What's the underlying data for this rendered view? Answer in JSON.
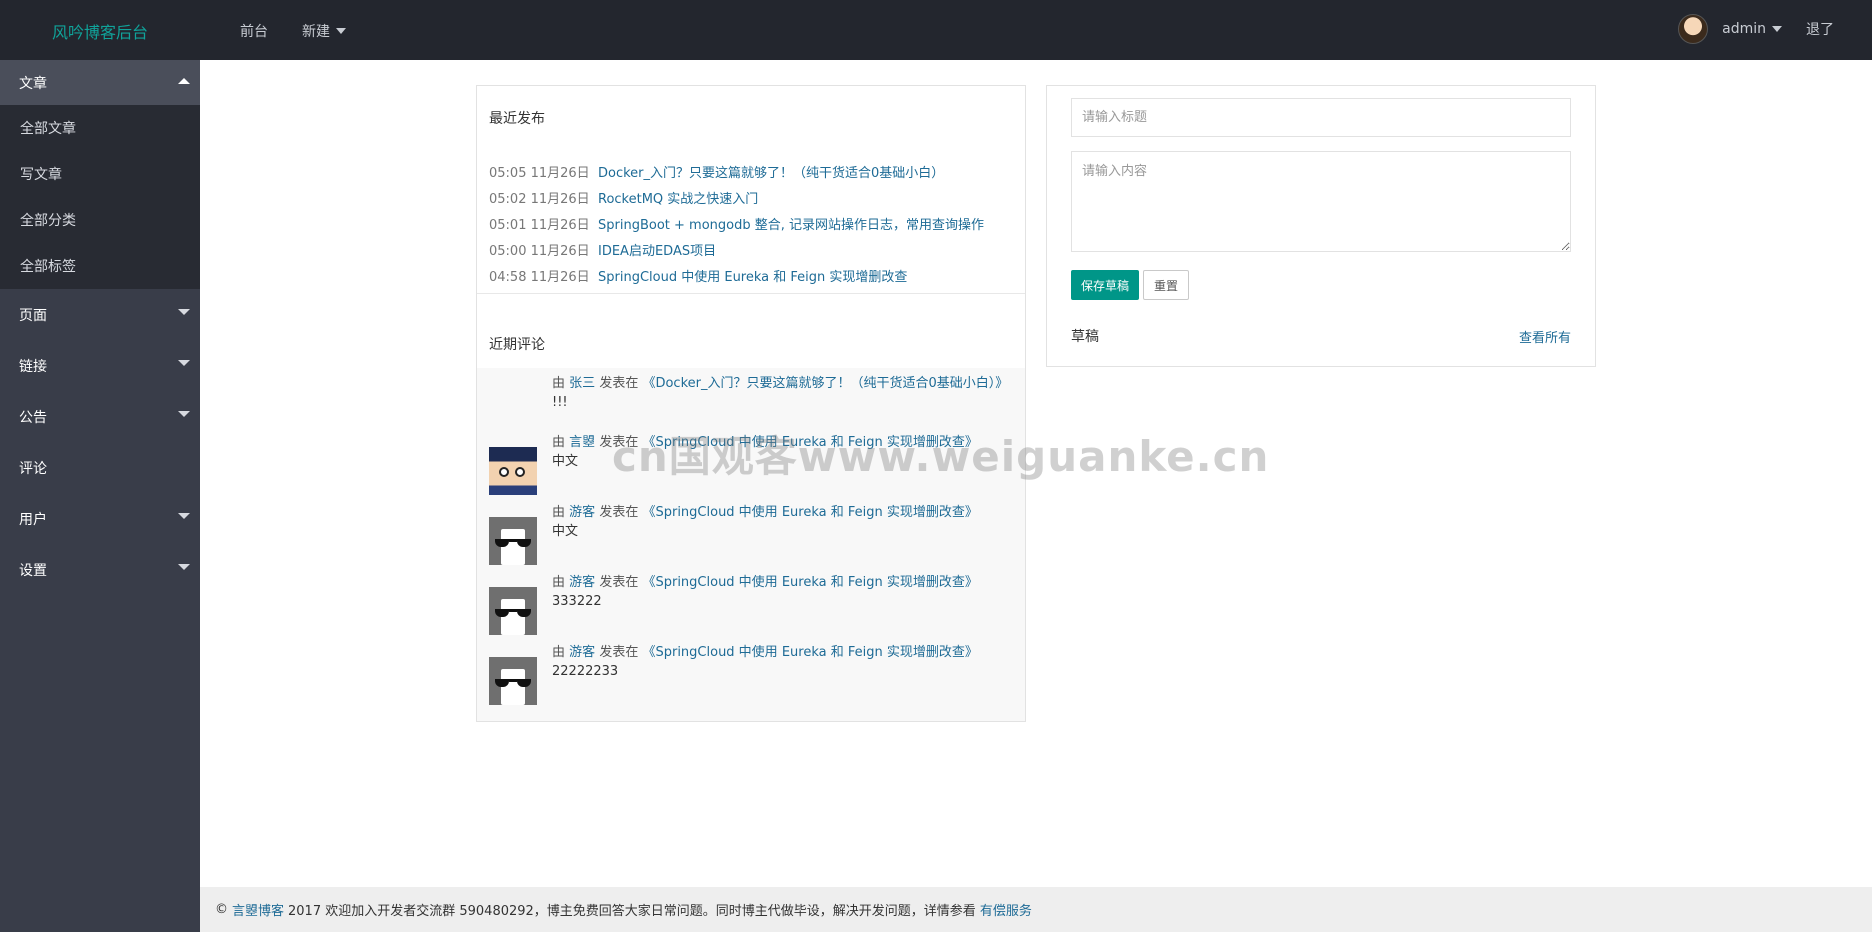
{
  "header": {
    "brand": "风吟博客后台",
    "nav": [
      {
        "label": "前台"
      },
      {
        "label": "新建"
      }
    ],
    "user": {
      "name": "admin",
      "logout": "退了"
    }
  },
  "sidebar": {
    "article_group": {
      "label": "文章",
      "items": [
        {
          "label": "全部文章"
        },
        {
          "label": "写文章"
        },
        {
          "label": "全部分类"
        },
        {
          "label": "全部标签"
        }
      ]
    },
    "groups": [
      {
        "label": "页面"
      },
      {
        "label": "链接"
      },
      {
        "label": "公告"
      },
      {
        "label": "评论"
      },
      {
        "label": "用户"
      },
      {
        "label": "设置"
      }
    ]
  },
  "recent_posts": {
    "title": "最近发布",
    "items": [
      {
        "time": "05:05 11月26日",
        "title": "Docker_入门？只要这篇就够了！（纯干货适合0基础小白）"
      },
      {
        "time": "05:02 11月26日",
        "title": "RocketMQ 实战之快速入门"
      },
      {
        "time": "05:01 11月26日",
        "title": "SpringBoot + mongodb 整合, 记录网站操作日志，常用查询操作"
      },
      {
        "time": "05:00 11月26日",
        "title": "IDEA启动EDAS项目"
      },
      {
        "time": "04:58 11月26日",
        "title": "SpringCloud 中使用 Eureka 和 Feign 实现增删改查"
      }
    ]
  },
  "recent_comments": {
    "title": "近期评论",
    "by_label": "由",
    "posted_label": "发表在",
    "items": [
      {
        "author": "张三",
        "article": "《Docker_入门？只要这篇就够了！（纯干货适合0基础小白）》",
        "content": "!!!",
        "avatar": "none"
      },
      {
        "author": "言曌",
        "article": "《SpringCloud 中使用 Eureka 和 Feign 实现增删改查》",
        "content": "中文",
        "avatar": "anime-avatar"
      },
      {
        "author": "游客",
        "article": "《SpringCloud 中使用 Eureka 和 Feign 实现增删改查》",
        "content": "中文",
        "avatar": "sunglasses-cat-avatar"
      },
      {
        "author": "游客",
        "article": "《SpringCloud 中使用 Eureka 和 Feign 实现增删改查》",
        "content": "333222",
        "avatar": "sunglasses-cat-avatar"
      },
      {
        "author": "游客",
        "article": "《SpringCloud 中使用 Eureka 和 Feign 实现增删改查》",
        "content": "22222233",
        "avatar": "sunglasses-cat-avatar"
      }
    ]
  },
  "draft_form": {
    "title_placeholder": "请输入标题",
    "content_placeholder": "请输入内容",
    "save_label": "保存草稿",
    "reset_label": "重置",
    "drafts_label": "草稿",
    "view_all_label": "查看所有"
  },
  "watermark": "cn国观客www.weiguanke.cn",
  "footer": {
    "prefix": "©",
    "site_link": "言曌博客",
    "text": "2017 欢迎加入开发者交流群 590480292，博主免费回答大家日常问题。同时博主代做毕设，解决开发问题，详情参看",
    "service_link": "有偿服务"
  },
  "colors": {
    "header_bg": "#23262e",
    "sidebar_bg": "#393d49",
    "sidebar_sub_bg": "#282b33",
    "brand": "#10a39a",
    "link": "#1e6b96",
    "primary_button": "#009688"
  }
}
